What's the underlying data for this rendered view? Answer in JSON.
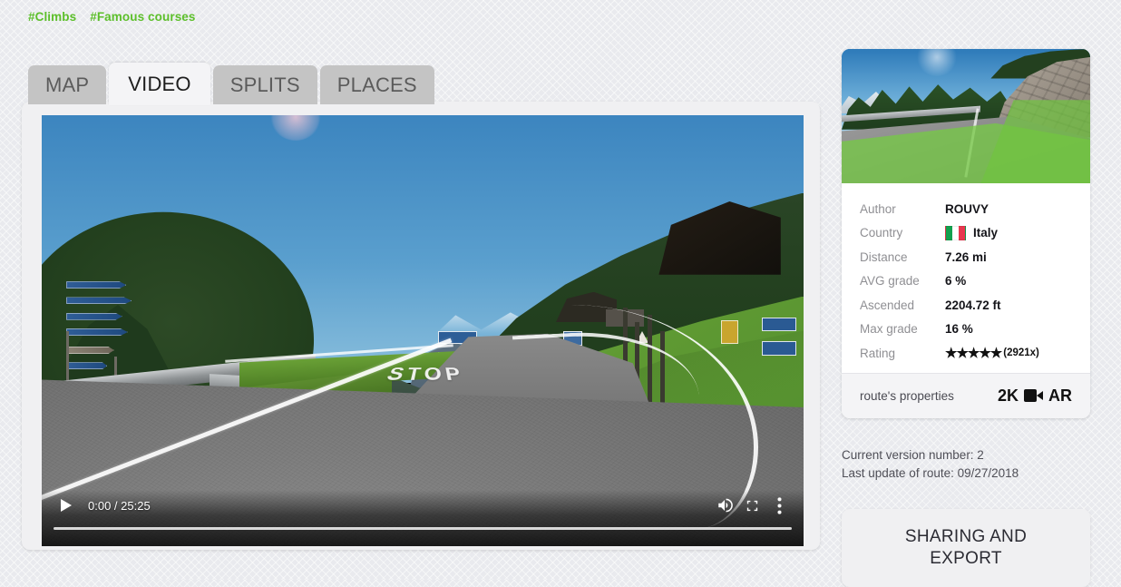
{
  "hashtags": [
    {
      "label": "#Climbs"
    },
    {
      "label": "#Famous courses"
    }
  ],
  "tabs": [
    {
      "label": "MAP",
      "active": false
    },
    {
      "label": "VIDEO",
      "active": true
    },
    {
      "label": "SPLITS",
      "active": false
    },
    {
      "label": "PLACES",
      "active": false
    }
  ],
  "video": {
    "current_time": "0:00",
    "duration": "25:25",
    "time_display": "0:00 / 25:25",
    "overlay_text": "STOP",
    "icons": {
      "play": "play-icon",
      "volume": "volume-icon",
      "fullscreen": "fullscreen-icon",
      "more": "more-options-icon"
    },
    "progress_percent": 0
  },
  "info_card": {
    "rows": [
      {
        "label": "Author",
        "value": "ROUVY"
      },
      {
        "label": "Country",
        "value": "Italy"
      },
      {
        "label": "Distance",
        "value": "7.26 mi"
      },
      {
        "label": "AVG grade",
        "value": "6 %"
      },
      {
        "label": "Ascended",
        "value": "2204.72 ft"
      },
      {
        "label": "Max grade",
        "value": "16 %"
      },
      {
        "label": "Rating",
        "value": ""
      }
    ],
    "rating": {
      "stars": "★★★★★",
      "count": "(2921x)",
      "value": 5
    },
    "footer": {
      "label": "route's properties",
      "badge_resolution": "2K",
      "badge_ar": "AR",
      "camera_icon": "video-camera-icon"
    }
  },
  "version_info": {
    "current_version": "Current version number: 2",
    "last_update": "Last update of route: 09/27/2018"
  },
  "sharing": {
    "title_line1": "SHARING AND",
    "title_line2": "EXPORT"
  },
  "colors": {
    "accent_green": "#5cbf2a",
    "page_bg": "#e9eaee",
    "panel_bg": "#f0f0f2",
    "card_bg": "#ffffff",
    "tab_inactive": "#c4c4c4",
    "label_gray": "#8f8f93"
  }
}
